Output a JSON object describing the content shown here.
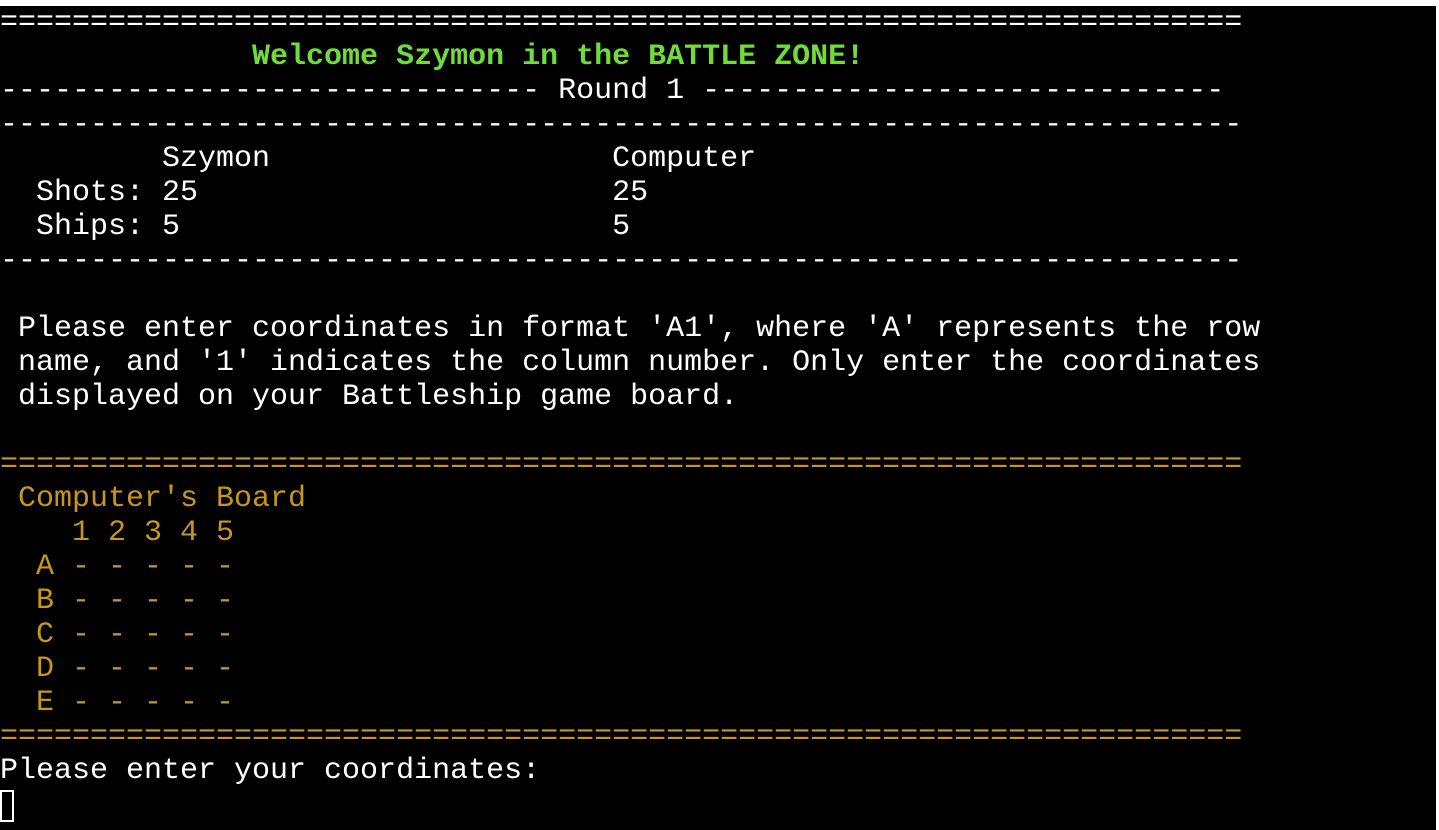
{
  "header": {
    "top_rule": "=====================================================================",
    "welcome": "              Welcome Szymon in the BATTLE ZONE!",
    "round_line": "------------------------------ Round 1 -----------------------------",
    "rule": "---------------------------------------------------------------------"
  },
  "scoreboard": {
    "names_line": "         Szymon                   Computer",
    "shots_line": "  Shots: 25                       25",
    "ships_line": "  Ships: 5                        5",
    "bottom_rule": "---------------------------------------------------------------------"
  },
  "instructions": {
    "line1": " Please enter coordinates in format 'A1', where 'A' represents the row",
    "line2": " name, and '1' indicates the column number. Only enter the coordinates",
    "line3": " displayed on your Battleship game board."
  },
  "board": {
    "top_rule": "=====================================================================",
    "title": " Computer's Board",
    "column_header": "    1 2 3 4 5",
    "rows": [
      "  A - - - - -",
      "  B - - - - -",
      "  C - - - - -",
      "  D - - - - -",
      "  E - - - - -"
    ],
    "bottom_rule": "====================================================================="
  },
  "prompt": {
    "text": "Please enter your coordinates:"
  },
  "colors": {
    "background": "#000000",
    "text": "#ffffff",
    "title_green": "#6fdc3c",
    "board_gold": "#c8961e"
  }
}
